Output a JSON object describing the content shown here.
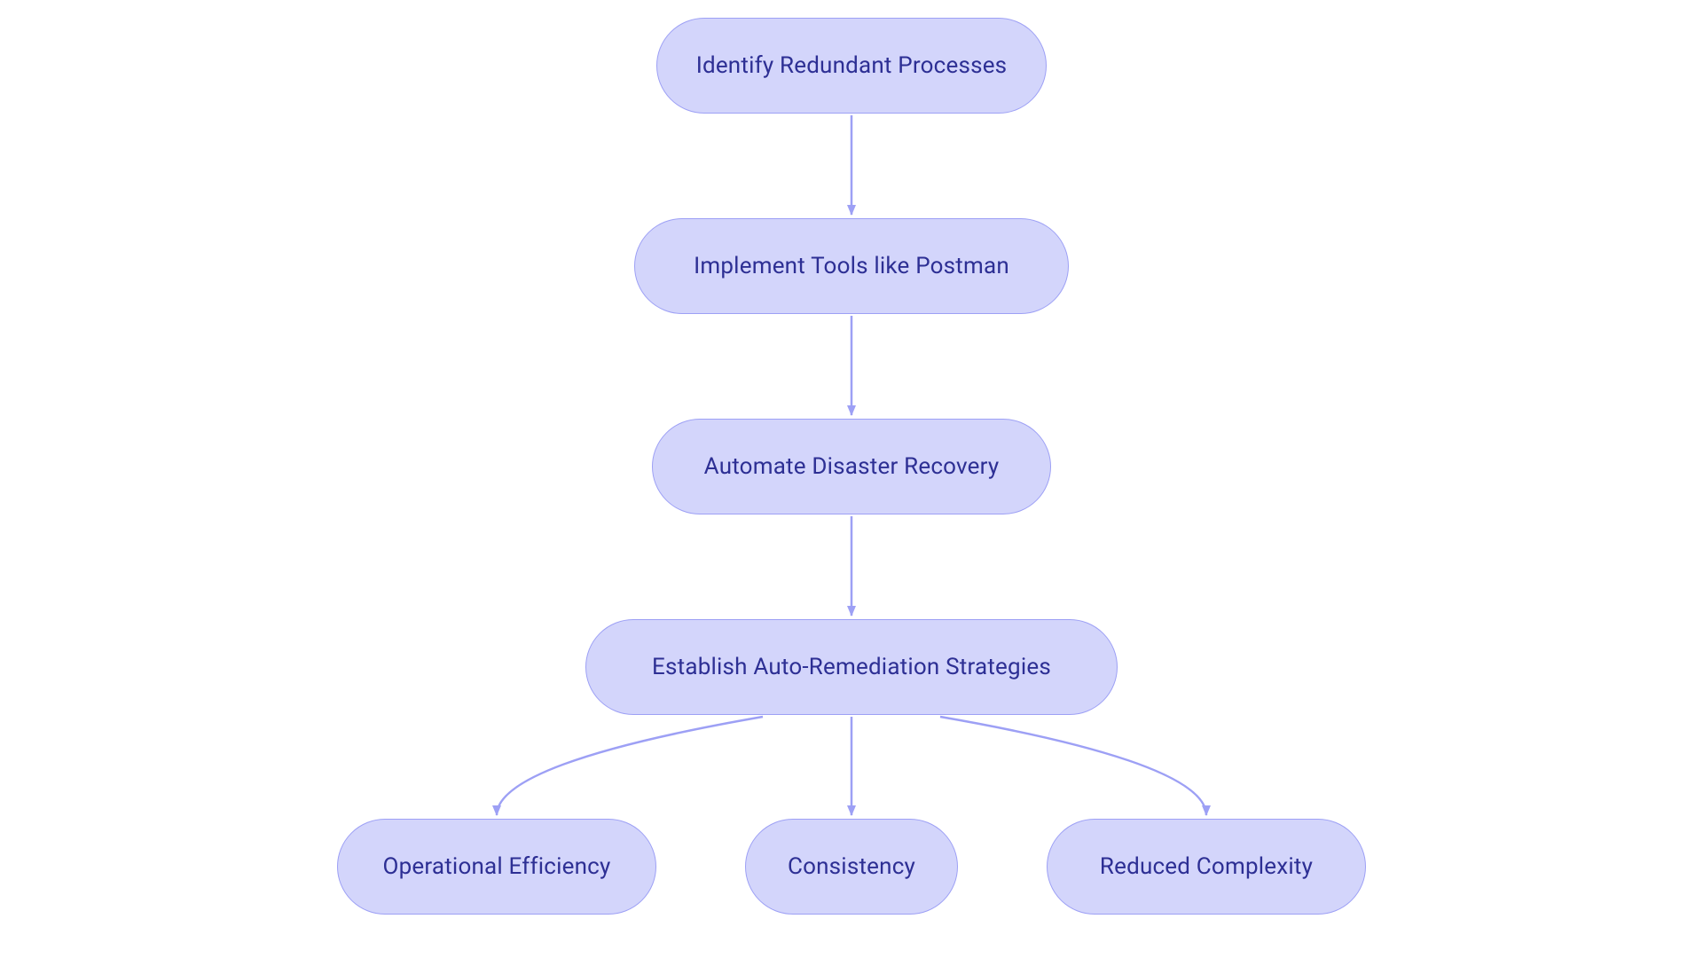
{
  "colors": {
    "node_fill": "#d3d5fb",
    "node_border": "#9da0f5",
    "node_text": "#2d2f94",
    "edge": "#9da0f5",
    "background": "#ffffff"
  },
  "nodes": {
    "n1": {
      "label": "Identify Redundant Processes"
    },
    "n2": {
      "label": "Implement Tools like Postman"
    },
    "n3": {
      "label": "Automate Disaster Recovery"
    },
    "n4": {
      "label": "Establish Auto-Remediation Strategies"
    },
    "n5": {
      "label": "Operational Efficiency"
    },
    "n6": {
      "label": "Consistency"
    },
    "n7": {
      "label": "Reduced Complexity"
    }
  },
  "edges": [
    {
      "from": "n1",
      "to": "n2"
    },
    {
      "from": "n2",
      "to": "n3"
    },
    {
      "from": "n3",
      "to": "n4"
    },
    {
      "from": "n4",
      "to": "n5"
    },
    {
      "from": "n4",
      "to": "n6"
    },
    {
      "from": "n4",
      "to": "n7"
    }
  ]
}
